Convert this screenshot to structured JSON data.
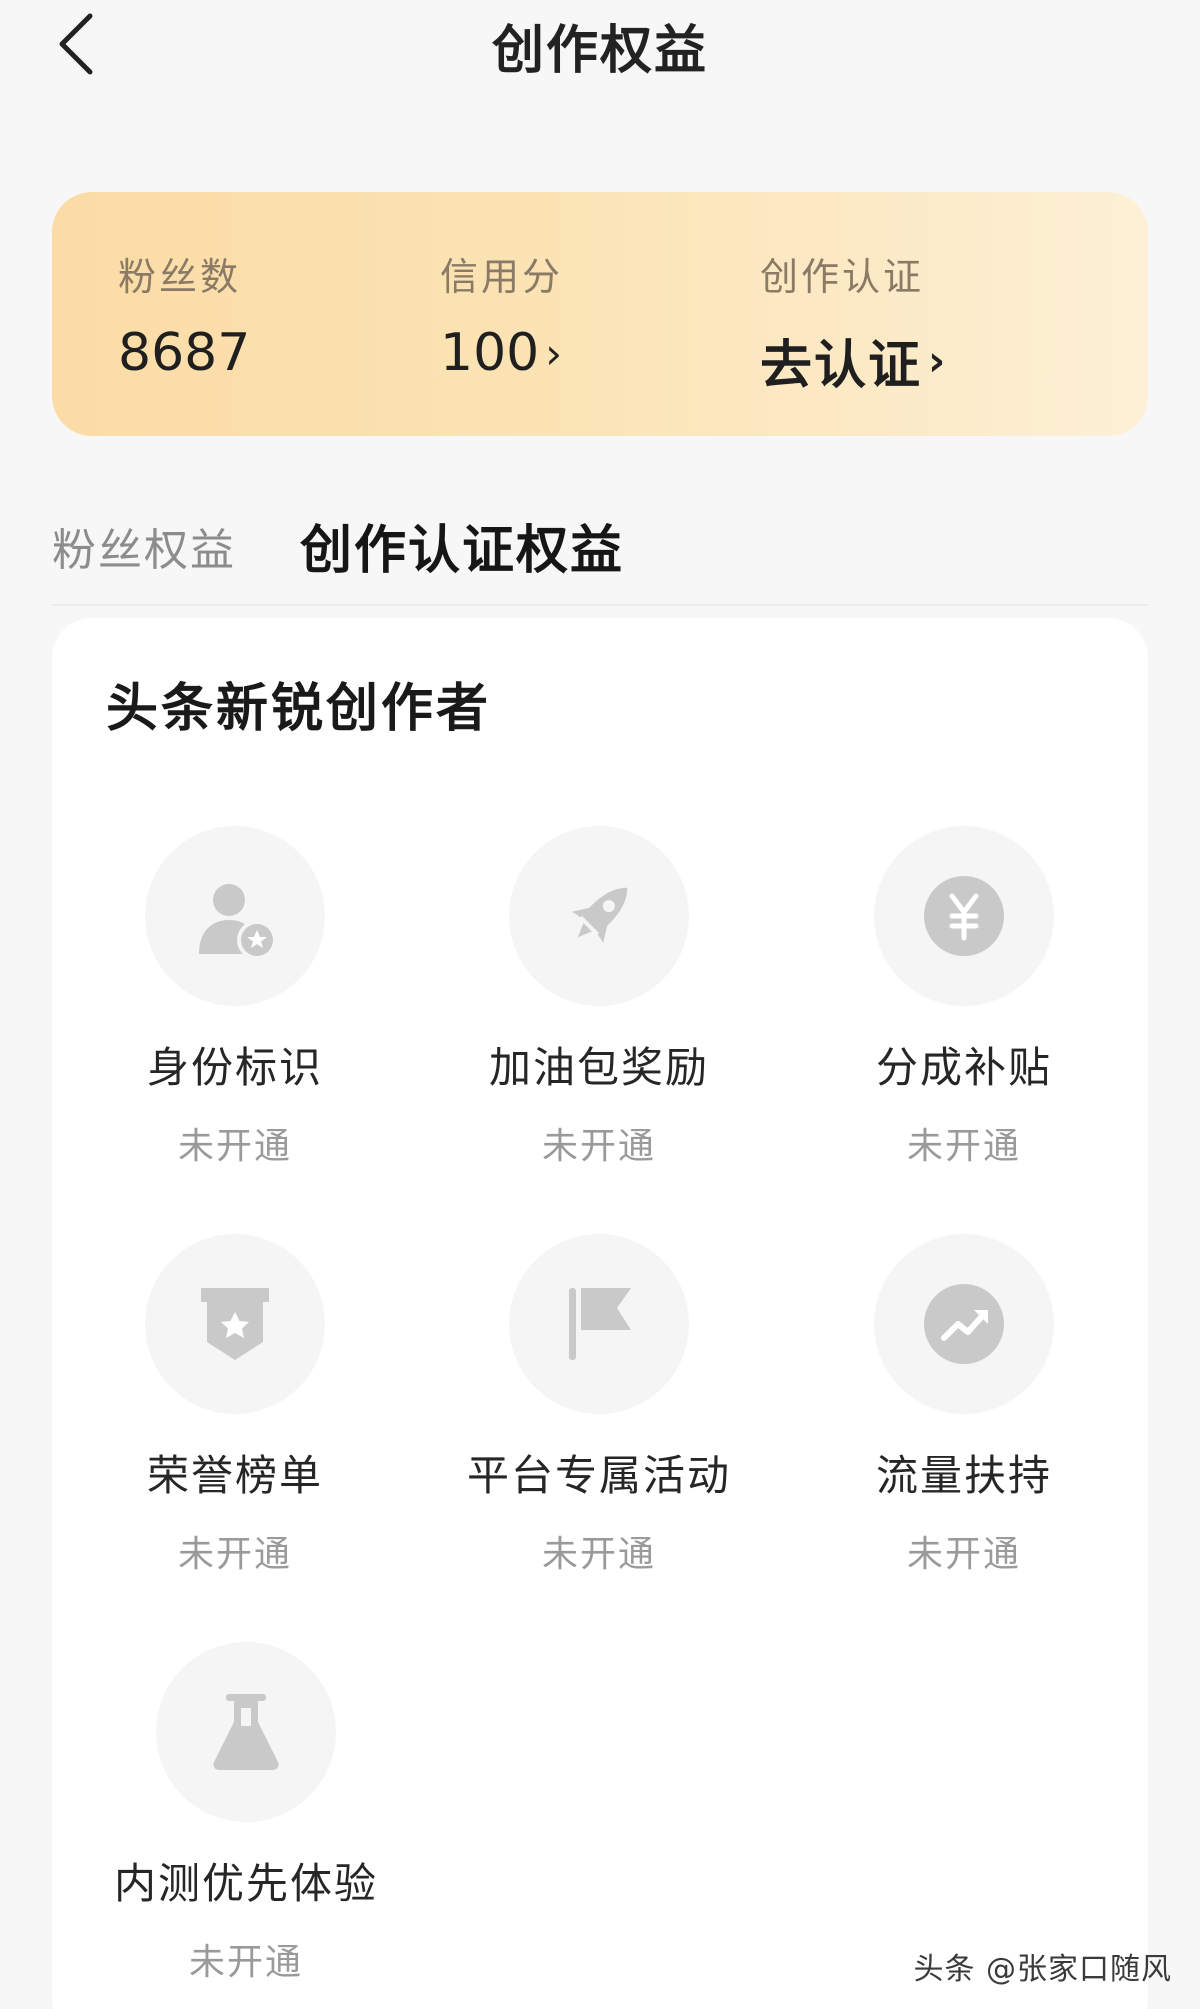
{
  "header": {
    "title": "创作权益"
  },
  "stats": {
    "fans": {
      "label": "粉丝数",
      "value": "8687"
    },
    "credit": {
      "label": "信用分",
      "value": "100"
    },
    "certification": {
      "label": "创作认证",
      "value": "去认证"
    }
  },
  "tabs": [
    {
      "label": "粉丝权益",
      "active": false
    },
    {
      "label": "创作认证权益",
      "active": true
    }
  ],
  "section": {
    "title": "头条新锐创作者"
  },
  "benefits": [
    {
      "name": "身份标识",
      "status": "未开通",
      "icon": "user-badge-icon"
    },
    {
      "name": "加油包奖励",
      "status": "未开通",
      "icon": "rocket-icon"
    },
    {
      "name": "分成补贴",
      "status": "未开通",
      "icon": "yuan-icon"
    },
    {
      "name": "荣誉榜单",
      "status": "未开通",
      "icon": "shield-star-icon"
    },
    {
      "name": "平台专属活动",
      "status": "未开通",
      "icon": "flag-icon"
    },
    {
      "name": "流量扶持",
      "status": "未开通",
      "icon": "trend-up-icon"
    },
    {
      "name": "内测优先体验",
      "status": "未开通",
      "icon": "flask-icon"
    }
  ],
  "watermark": "头条 @张家口随风",
  "colors": {
    "icon_gray": "#c9c9c9",
    "card_gold_start": "#fbdca6",
    "card_gold_end": "#fdf0d6"
  }
}
